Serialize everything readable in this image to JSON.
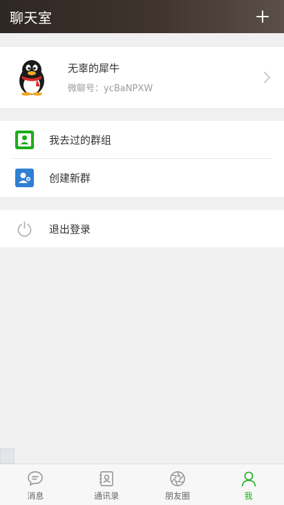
{
  "header": {
    "title": "聊天室",
    "add_icon": "plus-icon"
  },
  "profile": {
    "name": "无辜的犀牛",
    "wechat_id": "微聊号：ycBaNPXW",
    "avatar_icon": "penguin-avatar"
  },
  "menu": {
    "groups_label": "我去过的群组",
    "groups_icon": "person-icon",
    "groups_icon_color": "#1aad19",
    "create_label": "创建新群",
    "create_icon": "add-person-icon",
    "create_icon_color": "#2f7fd3",
    "logout_label": "退出登录",
    "logout_icon": "power-icon"
  },
  "bottom_nav": {
    "tabs": [
      {
        "label": "消息",
        "icon": "chat-bubble-icon"
      },
      {
        "label": "通讯录",
        "icon": "contacts-book-icon"
      },
      {
        "label": "朋友圈",
        "icon": "aperture-icon"
      },
      {
        "label": "我",
        "icon": "person-outline-icon"
      }
    ],
    "active_color": "#1aad19",
    "inactive_color": "#666666"
  }
}
